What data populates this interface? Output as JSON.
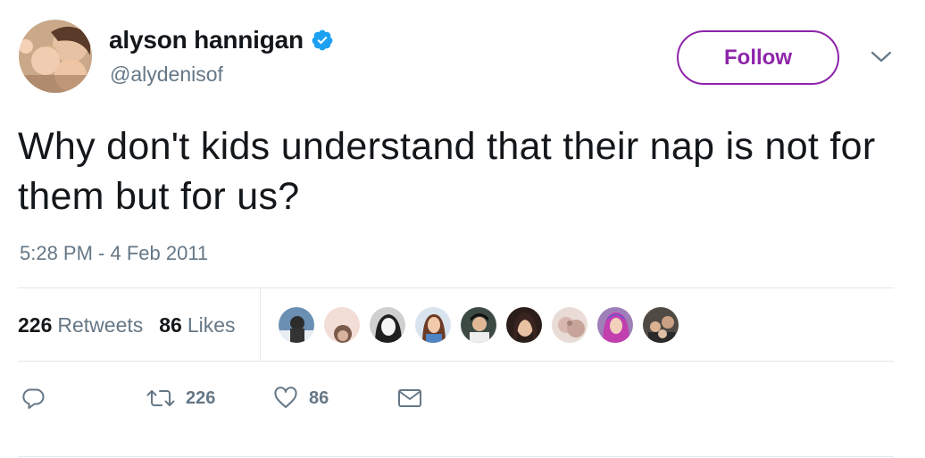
{
  "user": {
    "display_name": "alyson hannigan",
    "handle": "@alydenisof",
    "verified": true
  },
  "header": {
    "follow_label": "Follow",
    "accent_color": "#8e24aa"
  },
  "tweet": {
    "text": "Why don't kids understand that their nap is not for them but for us?",
    "timestamp": "5:28 PM - 4 Feb 2011"
  },
  "stats": {
    "retweets_count": "226",
    "retweets_label": "Retweets",
    "likes_count": "86",
    "likes_label": "Likes"
  },
  "likers": [
    {
      "icon": "liker-avatar-1"
    },
    {
      "icon": "liker-avatar-2"
    },
    {
      "icon": "liker-avatar-3"
    },
    {
      "icon": "liker-avatar-4"
    },
    {
      "icon": "liker-avatar-5"
    },
    {
      "icon": "liker-avatar-6"
    },
    {
      "icon": "liker-avatar-7"
    },
    {
      "icon": "liker-avatar-8"
    },
    {
      "icon": "liker-avatar-9"
    }
  ],
  "actions": {
    "reply_icon": "reply-icon",
    "retweet_icon": "retweet-icon",
    "retweet_count": "226",
    "like_icon": "heart-icon",
    "like_count": "86",
    "dm_icon": "envelope-icon"
  }
}
